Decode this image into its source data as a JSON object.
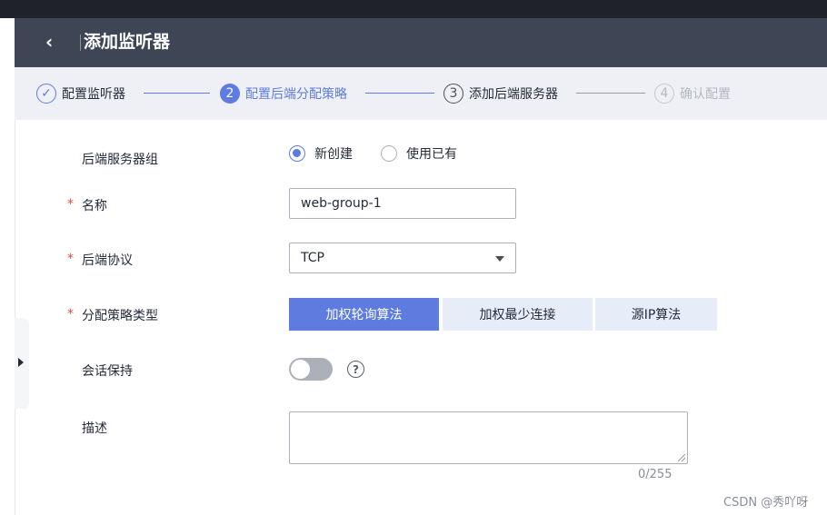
{
  "header": {
    "back_icon": "chevron-left-icon",
    "title": "添加监听器"
  },
  "steps": [
    {
      "number": "✓",
      "label": "配置监听器",
      "state": "done"
    },
    {
      "number": "2",
      "label": "配置后端分配策略",
      "state": "active"
    },
    {
      "number": "3",
      "label": "添加后端服务器",
      "state": "pending"
    },
    {
      "number": "4",
      "label": "确认配置",
      "state": "disabled"
    }
  ],
  "form": {
    "backend_group": {
      "label": "后端服务器组",
      "options": [
        {
          "label": "新创建",
          "selected": true
        },
        {
          "label": "使用已有",
          "selected": false
        }
      ]
    },
    "name": {
      "label": "名称",
      "required_mark": "*",
      "value": "web-group-1"
    },
    "protocol": {
      "label": "后端协议",
      "required_mark": "*",
      "value": "TCP"
    },
    "strategy": {
      "label": "分配策略类型",
      "required_mark": "*",
      "options": [
        {
          "label": "加权轮询算法",
          "selected": true
        },
        {
          "label": "加权最少连接",
          "selected": false
        },
        {
          "label": "源IP算法",
          "selected": false
        }
      ]
    },
    "session": {
      "label": "会话保持",
      "enabled": false,
      "help_glyph": "?"
    },
    "description": {
      "label": "描述",
      "value": "",
      "counter": "0/255"
    }
  },
  "watermark": "CSDN @秀吖呀",
  "colors": {
    "accent": "#5e7ce0",
    "header_bg": "#3e4554",
    "required": "#e84a3e",
    "segment_idle": "#e7edf8"
  }
}
